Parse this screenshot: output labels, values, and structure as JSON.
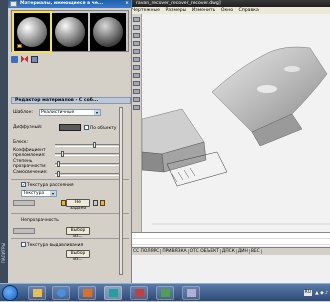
{
  "left_strip": {
    "label": "ПАЛИТРЫ"
  },
  "palette": {
    "title": "Материалы, имеющиеся в че...",
    "close": "×"
  },
  "editor": {
    "title": "Редактор материалов - С соб...",
    "template_label": "Шаблон:",
    "template_value": "Реалистичные",
    "diffuse_label": "Диффузный:",
    "by_object_label": "По объекту",
    "gloss_label": "Блеск:",
    "refraction_label": "Коэффициент преломления:",
    "translucency_label": "Степень прозрачности:",
    "self_illum_label": "Самосвечение:",
    "diffuse_texture_label": "Текстура рассеяния",
    "texture_type": "Текстура",
    "file_button": "Не задано",
    "opacity_label": "Непрозрачность",
    "opacity_button": "Выбор из...",
    "bump_label": "Текстура выдавливания",
    "bump_button": "Выбор из...",
    "checkmark": "✓"
  },
  "cad": {
    "window_title": "ravan_recover_recover_recover.dwg]",
    "menu": [
      "Чертежные",
      "Размеры",
      "Изменить",
      "Окно",
      "Справка"
    ],
    "status_items": [
      "СС ПОЛЯРС",
      "ПРИВЯЗКА",
      "ОТС ОБЪЕКТ",
      "ДПСК",
      "ДИН",
      "ВЕС"
    ]
  },
  "taskbar": {
    "language": "RU"
  }
}
